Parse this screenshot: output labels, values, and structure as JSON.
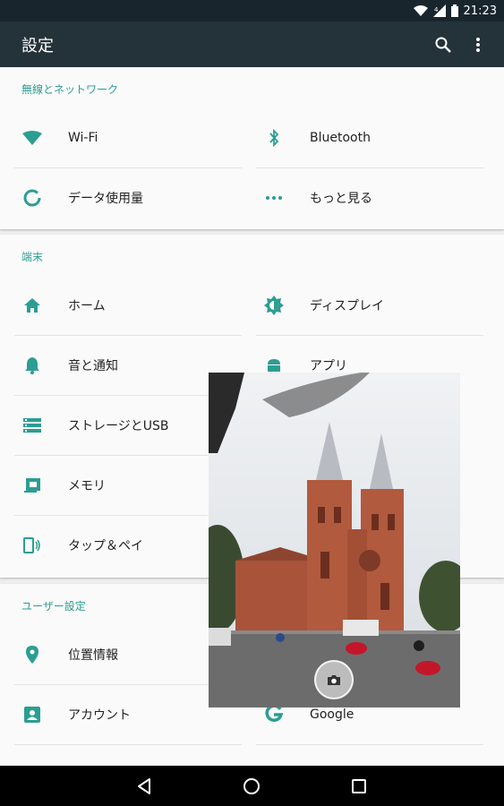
{
  "status_bar": {
    "time": "21:23"
  },
  "app_bar": {
    "title": "設定"
  },
  "sections": {
    "network": {
      "title": "無線とネットワーク",
      "items": [
        {
          "label": "Wi-Fi",
          "icon": "wifi-icon"
        },
        {
          "label": "Bluetooth",
          "icon": "bluetooth-icon"
        },
        {
          "label": "データ使用量",
          "icon": "data-usage-icon"
        },
        {
          "label": "もっと見る",
          "icon": "more-horiz-icon"
        }
      ]
    },
    "device": {
      "title": "端末",
      "items": [
        {
          "label": "ホーム",
          "icon": "home-icon"
        },
        {
          "label": "ディスプレイ",
          "icon": "brightness-icon"
        },
        {
          "label": "音と通知",
          "icon": "bell-icon"
        },
        {
          "label": "アプリ",
          "icon": "android-icon"
        },
        {
          "label": "ストレージとUSB",
          "icon": "storage-icon"
        },
        {
          "label": "メモリ",
          "icon": "memory-icon"
        },
        {
          "label": "タップ＆ペイ",
          "icon": "tap-pay-icon"
        }
      ]
    },
    "user": {
      "title": "ユーザー設定",
      "items": [
        {
          "label": "位置情報",
          "icon": "location-icon"
        },
        {
          "label": "アカウント",
          "icon": "account-icon"
        },
        {
          "label": "Google",
          "icon": "google-icon"
        }
      ]
    }
  },
  "colors": {
    "accent": "#2c9d92",
    "app_bar": "#243239",
    "status_bar": "#18252d"
  }
}
